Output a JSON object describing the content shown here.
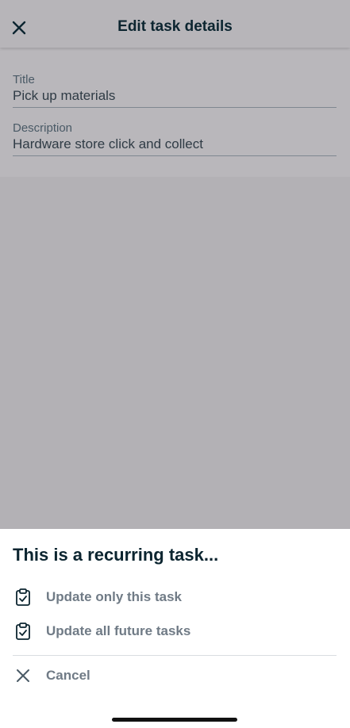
{
  "header": {
    "title": "Edit task details",
    "close_icon": "close-icon"
  },
  "form": {
    "title_label": "Title",
    "title_value": "Pick up materials",
    "description_label": "Description",
    "description_value": "Hardware store click and collect"
  },
  "sheet": {
    "heading": "This is a recurring task...",
    "options": [
      {
        "label": "Update only this task",
        "icon": "clipboard-check-icon"
      },
      {
        "label": "Update all future tasks",
        "icon": "clipboard-check-icon"
      }
    ],
    "cancel_label": "Cancel",
    "cancel_icon": "close-icon"
  },
  "colors": {
    "overlay": "#b3b1b5",
    "heading_text": "#0c2530",
    "option_text": "#707b86"
  }
}
